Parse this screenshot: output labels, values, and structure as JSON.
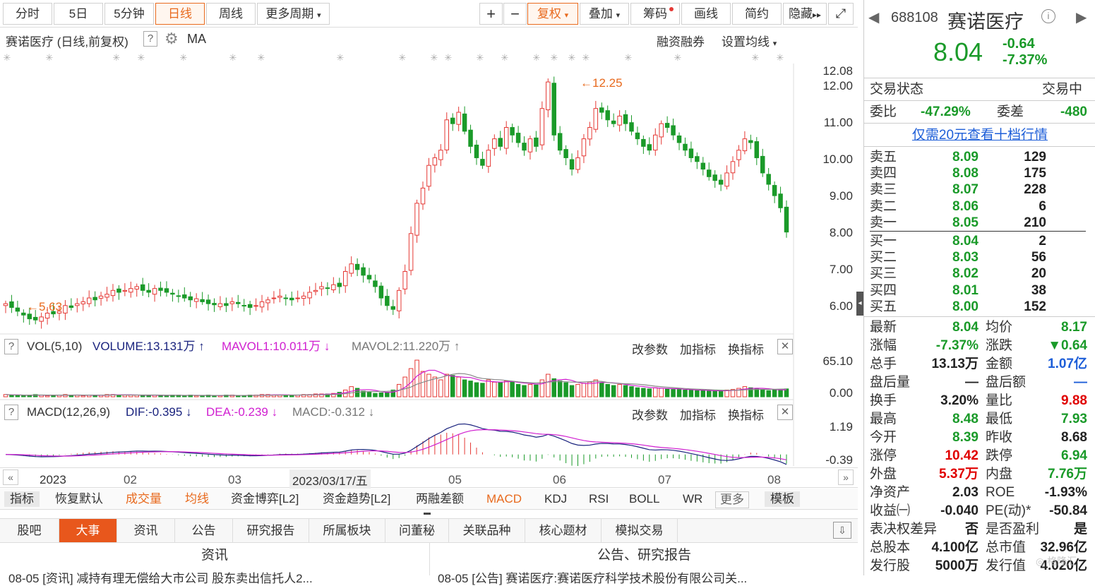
{
  "toolbar": {
    "periods": [
      "分时",
      "5日",
      "5分钟",
      "日线",
      "周线",
      "更多周期"
    ],
    "active_period": "日线",
    "zoom_in": "+",
    "zoom_out": "−",
    "fq": "复权",
    "overlay": "叠加",
    "chips": "筹码",
    "draw": "画线",
    "simple": "简约",
    "hide": "隐藏"
  },
  "chart_header": {
    "title": "赛诺医疗 (日线,前复权)",
    "help": "?",
    "ma": "MA",
    "margin_trading": "融资融券",
    "set_ma": "设置均线"
  },
  "price_axis": {
    "ticks": [
      "12.08",
      "12.00",
      "11.00",
      "10.00",
      "9.00",
      "8.00",
      "7.00",
      "6.00"
    ]
  },
  "annotations": {
    "high": "12.25",
    "low": "5.63"
  },
  "vol_pane": {
    "title": "VOL(5,10)",
    "volume": "VOLUME:13.131万",
    "mavol1": "MAVOL1:10.011万",
    "mavol2": "MAVOL2:11.220万",
    "axis_top": "65.10",
    "axis_bottom": "0.00",
    "btn_params": "改参数",
    "btn_add": "加指标",
    "btn_switch": "换指标"
  },
  "macd_pane": {
    "title": "MACD(12,26,9)",
    "dif": "DIF:-0.395",
    "dea": "DEA:-0.239",
    "macd": "MACD:-0.312",
    "axis_top": "1.19",
    "axis_bottom": "-0.39",
    "btn_params": "改参数",
    "btn_add": "加指标",
    "btn_switch": "换指标"
  },
  "date_axis": [
    "2023",
    "02",
    "03",
    "2023/03/17/五",
    "05",
    "06",
    "07",
    "08"
  ],
  "indicator_tabs": [
    "指标",
    "恢复默认",
    "成交量",
    "均线",
    "资金博弈[L2]",
    "资金趋势[L2]",
    "两融差额",
    "MACD",
    "KDJ",
    "RSI",
    "BOLL",
    "WR",
    "更多",
    "模板"
  ],
  "bottom_tabs": [
    "股吧",
    "大事",
    "资讯",
    "公告",
    "研究报告",
    "所属板块",
    "问董秘",
    "关联品种",
    "核心题材",
    "模拟交易"
  ],
  "bottom_active": "大事",
  "news": {
    "left_title": "资讯",
    "right_title": "公告、研究报告",
    "left_row": "08-05  [资讯] 减持有理无偿给大市公司 股东卖出信托人2...",
    "right_row": "08-05  [公告] 赛诺医疗:赛诺医疗科学技术股份有限公司关..."
  },
  "quote": {
    "code": "688108",
    "name": "赛诺医疗",
    "price": "8.04",
    "change": "-0.64",
    "change_pct": "-7.37%",
    "status_label": "交易状态",
    "status_value": "交易中",
    "wb_label": "委比",
    "wb_value": "-47.29%",
    "wc_label": "委差",
    "wc_value": "-480",
    "depth_link": "仅需20元查看十档行情",
    "asks": [
      {
        "label": "卖五",
        "price": "8.09",
        "vol": "129"
      },
      {
        "label": "卖四",
        "price": "8.08",
        "vol": "175"
      },
      {
        "label": "卖三",
        "price": "8.07",
        "vol": "228"
      },
      {
        "label": "卖二",
        "price": "8.06",
        "vol": "6"
      },
      {
        "label": "卖一",
        "price": "8.05",
        "vol": "210"
      }
    ],
    "bids": [
      {
        "label": "买一",
        "price": "8.04",
        "vol": "2"
      },
      {
        "label": "买二",
        "price": "8.03",
        "vol": "56"
      },
      {
        "label": "买三",
        "price": "8.02",
        "vol": "20"
      },
      {
        "label": "买四",
        "price": "8.01",
        "vol": "38"
      },
      {
        "label": "买五",
        "price": "8.00",
        "vol": "152"
      }
    ],
    "stats": [
      {
        "l1": "最新",
        "v1": "8.04",
        "c1": "grn",
        "l2": "均价",
        "v2": "8.17",
        "c2": "grn"
      },
      {
        "l1": "涨幅",
        "v1": "-7.37%",
        "c1": "grn",
        "l2": "涨跌",
        "v2": "▼0.64",
        "c2": "grn"
      },
      {
        "l1": "总手",
        "v1": "13.13万",
        "c1": "blk",
        "l2": "金额",
        "v2": "1.07亿",
        "c2": "blu"
      },
      {
        "l1": "盘后量",
        "v1": "—",
        "c1": "blk",
        "l2": "盘后额",
        "v2": "—",
        "c2": "blu"
      },
      {
        "l1": "换手",
        "v1": "3.20%",
        "c1": "blk",
        "l2": "量比",
        "v2": "9.88",
        "c2": "red"
      },
      {
        "l1": "最高",
        "v1": "8.48",
        "c1": "grn",
        "l2": "最低",
        "v2": "7.93",
        "c2": "grn"
      },
      {
        "l1": "今开",
        "v1": "8.39",
        "c1": "grn",
        "l2": "昨收",
        "v2": "8.68",
        "c2": "blk"
      },
      {
        "l1": "涨停",
        "v1": "10.42",
        "c1": "red",
        "l2": "跌停",
        "v2": "6.94",
        "c2": "grn"
      },
      {
        "l1": "外盘",
        "v1": "5.37万",
        "c1": "red",
        "l2": "内盘",
        "v2": "7.76万",
        "c2": "grn"
      },
      {
        "l1": "净资产",
        "v1": "2.03",
        "c1": "blk",
        "l2": "ROE",
        "v2": "-1.93%",
        "c2": "blk"
      },
      {
        "l1": "收益㈠",
        "v1": "-0.040",
        "c1": "blk",
        "l2": "PE(动)*",
        "v2": "-50.84",
        "c2": "blk"
      },
      {
        "l1": "表决权差异",
        "v1": "否",
        "c1": "blk",
        "l2": "是否盈利",
        "v2": "是",
        "c2": "blk"
      },
      {
        "l1": "总股本",
        "v1": "4.100亿",
        "c1": "blk",
        "l2": "总市值",
        "v2": "32.96亿",
        "c2": "blk"
      },
      {
        "l1": "发行股",
        "v1": "5000万",
        "c1": "blk",
        "l2": "发行值",
        "v2": "4.020亿",
        "c2": "blk"
      }
    ]
  },
  "watermark": "格隆汇",
  "colors": {
    "up": "#e53935",
    "down": "#1a9a29",
    "accent": "#e86a1e",
    "mavol1": "#d01fd0",
    "link": "#1d5ed8"
  },
  "chart_data": {
    "type": "candlestick",
    "ylim": [
      5.5,
      12.3
    ],
    "high_label": 12.25,
    "low_label": 5.63,
    "close": [
      6.15,
      6.05,
      5.95,
      5.85,
      5.75,
      5.72,
      5.8,
      5.9,
      5.88,
      5.95,
      6.1,
      6.05,
      6.15,
      6.2,
      6.3,
      6.25,
      6.35,
      6.4,
      6.5,
      6.45,
      6.5,
      6.55,
      6.6,
      6.5,
      6.45,
      6.55,
      6.5,
      6.45,
      6.4,
      6.35,
      6.3,
      6.25,
      6.28,
      6.2,
      6.15,
      6.12,
      6.15,
      6.1,
      6.2,
      6.15,
      6.1,
      6.05,
      6.1,
      6.2,
      6.25,
      6.3,
      6.35,
      6.3,
      6.25,
      6.3,
      6.35,
      6.45,
      6.5,
      6.6,
      6.55,
      6.65,
      6.6,
      7.0,
      7.2,
      7.05,
      6.9,
      6.8,
      6.6,
      6.3,
      6.1,
      6.0,
      6.5,
      7.0,
      8.0,
      8.8,
      9.2,
      9.8,
      10.0,
      10.2,
      11.0,
      10.9,
      11.2,
      10.7,
      10.3,
      10.0,
      9.8,
      10.2,
      10.5,
      10.3,
      10.8,
      10.6,
      10.4,
      10.2,
      10.5,
      10.3,
      11.3,
      12.0,
      10.6,
      10.2,
      10.0,
      9.7,
      10.0,
      10.5,
      10.8,
      11.3,
      11.2,
      11.0,
      10.9,
      11.1,
      10.9,
      10.7,
      10.5,
      10.3,
      10.2,
      10.6,
      10.9,
      10.8,
      10.6,
      10.4,
      10.2,
      10.0,
      9.9,
      9.7,
      9.5,
      9.4,
      9.3,
      9.6,
      9.9,
      10.2,
      10.5,
      10.4,
      10.0,
      9.6,
      9.3,
      9.0,
      8.68,
      8.04
    ],
    "volume": [
      4,
      3,
      3,
      2,
      3,
      4,
      3,
      2,
      3,
      3,
      4,
      3,
      3,
      2,
      3,
      3,
      3,
      4,
      4,
      3,
      3,
      3,
      3,
      2,
      3,
      3,
      2,
      2,
      3,
      3,
      2,
      3,
      2,
      2,
      3,
      2,
      2,
      3,
      3,
      2,
      2,
      3,
      3,
      4,
      4,
      3,
      3,
      3,
      3,
      3,
      4,
      4,
      5,
      5,
      5,
      6,
      8,
      12,
      18,
      15,
      10,
      8,
      6,
      7,
      8,
      12,
      22,
      35,
      50,
      65,
      45,
      40,
      35,
      30,
      40,
      38,
      35,
      30,
      28,
      25,
      24,
      30,
      26,
      25,
      28,
      27,
      22,
      20,
      22,
      21,
      30,
      40,
      32,
      28,
      25,
      20,
      22,
      24,
      26,
      30,
      25,
      22,
      20,
      22,
      20,
      18,
      16,
      15,
      14,
      16,
      15,
      14,
      13,
      13,
      12,
      12,
      11,
      11,
      10,
      10,
      11,
      12,
      13,
      15,
      18,
      16,
      14,
      12,
      11,
      12,
      13,
      14
    ]
  }
}
